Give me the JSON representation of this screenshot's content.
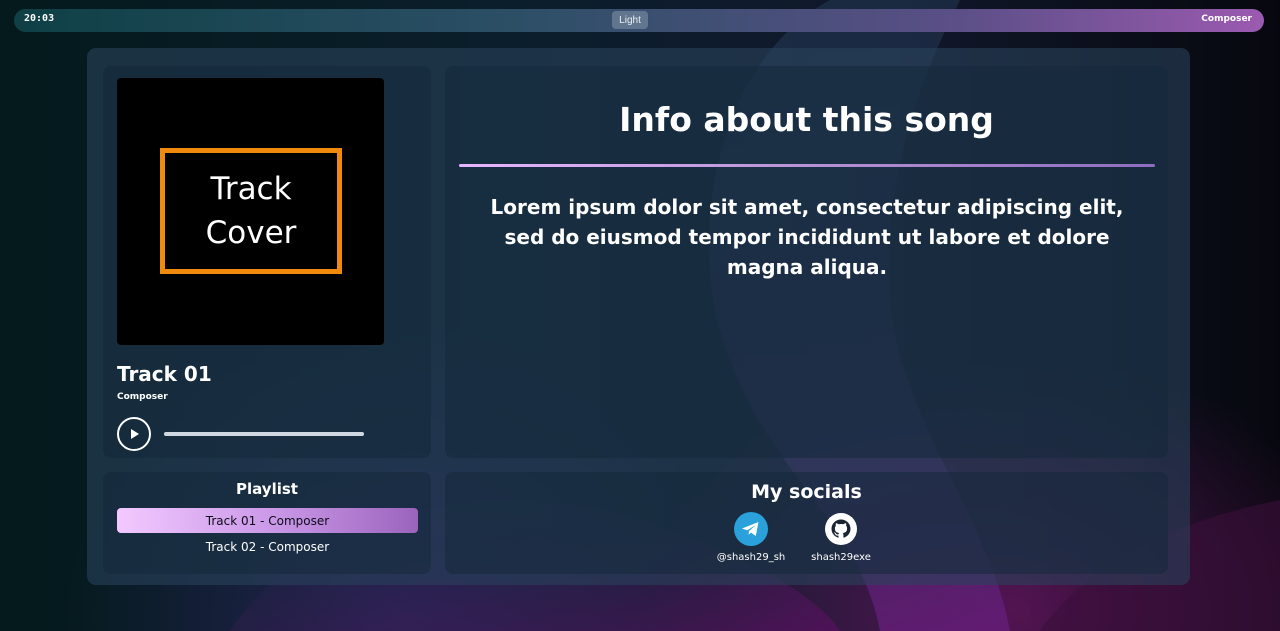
{
  "topbar": {
    "time": "20:03",
    "theme_button": "Light",
    "right_label": "Composer"
  },
  "player": {
    "cover_text": "Track\nCover",
    "track_title": "Track 01",
    "composer": "Composer",
    "progress": 1.0
  },
  "info": {
    "title": "Info about this song",
    "text": "Lorem ipsum dolor sit amet, consectetur adipiscing elit, sed do eiusmod tempor incididunt ut labore et dolore magna aliqua."
  },
  "playlist": {
    "title": "Playlist",
    "items": [
      {
        "label": "Track 01 - Composer",
        "active": true
      },
      {
        "label": "Track 02 - Composer",
        "active": false
      }
    ]
  },
  "socials": {
    "title": "My socials",
    "links": [
      {
        "icon": "telegram-icon",
        "handle": "@shash29_sh"
      },
      {
        "icon": "github-icon",
        "handle": "shash29exe"
      }
    ]
  },
  "colors": {
    "cover_frame": "#f08a0c",
    "accent_gradient_start": "#f2c9ff",
    "accent_gradient_end": "#9a64bc",
    "telegram": "#2aa1da"
  }
}
